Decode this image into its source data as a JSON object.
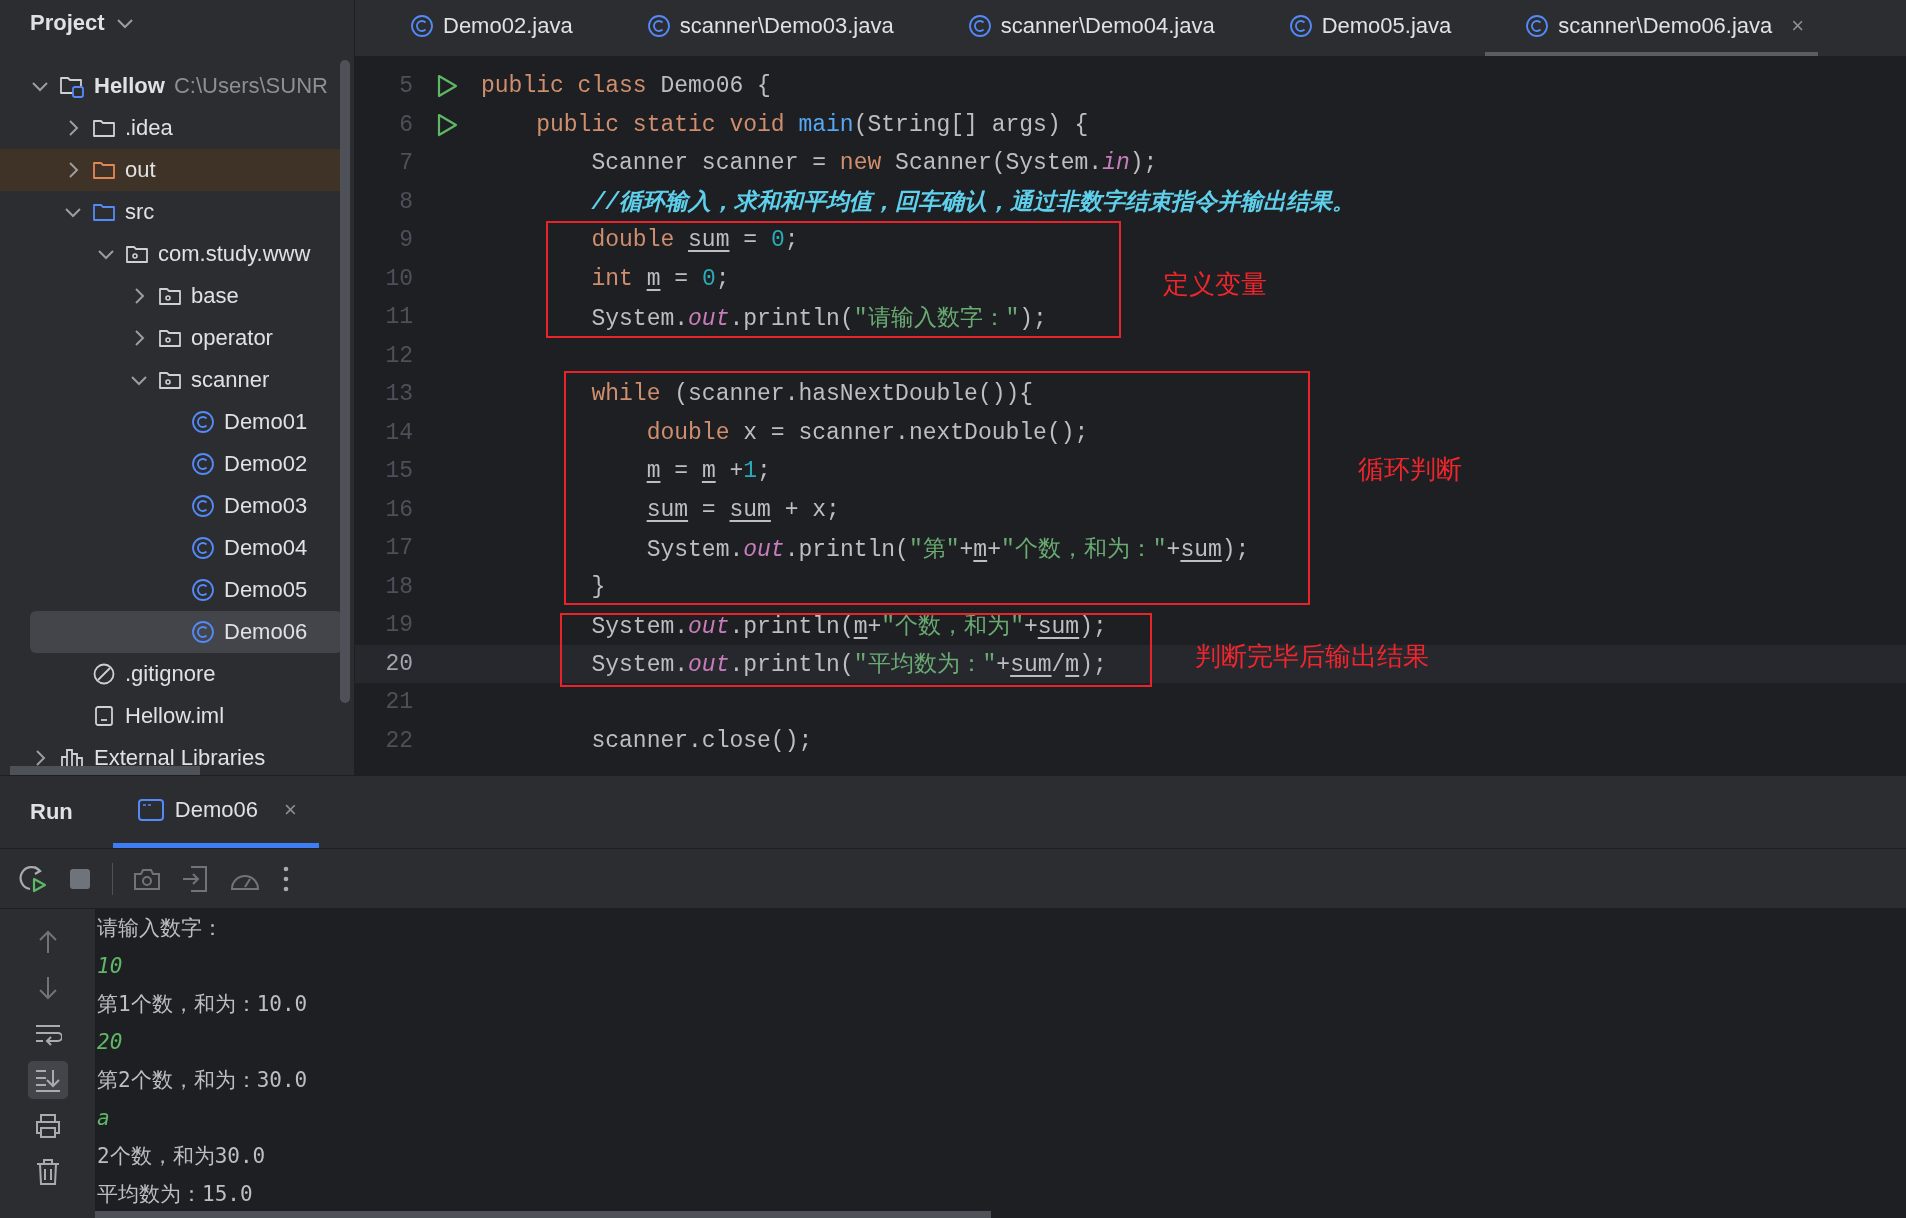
{
  "project_panel": {
    "title": "Project",
    "tree": [
      {
        "kind": "module",
        "label": "Hellow",
        "detail": "C:\\Users\\SUNR",
        "expanded": true,
        "selected": false,
        "children": [
          {
            "kind": "folder",
            "label": ".idea",
            "expanded": false,
            "selected": false
          },
          {
            "kind": "excluded-folder",
            "label": "out",
            "expanded": false,
            "selected": false
          },
          {
            "kind": "source-folder",
            "label": "src",
            "expanded": true,
            "selected": false,
            "children": [
              {
                "kind": "package",
                "label": "com.study.www",
                "expanded": true,
                "selected": false,
                "children": [
                  {
                    "kind": "package",
                    "label": "base",
                    "expanded": false,
                    "selected": false
                  },
                  {
                    "kind": "package",
                    "label": "operator",
                    "expanded": false,
                    "selected": false
                  },
                  {
                    "kind": "package",
                    "label": "scanner",
                    "expanded": true,
                    "selected": false,
                    "children": [
                      {
                        "kind": "class",
                        "label": "Demo01",
                        "selected": false
                      },
                      {
                        "kind": "class",
                        "label": "Demo02",
                        "selected": false
                      },
                      {
                        "kind": "class",
                        "label": "Demo03",
                        "selected": false
                      },
                      {
                        "kind": "class",
                        "label": "Demo04",
                        "selected": false
                      },
                      {
                        "kind": "class",
                        "label": "Demo05",
                        "selected": false
                      },
                      {
                        "kind": "class",
                        "label": "Demo06",
                        "selected": true
                      }
                    ]
                  }
                ]
              }
            ]
          },
          {
            "kind": "ignore-file",
            "label": ".gitignore",
            "selected": false
          },
          {
            "kind": "iml-file",
            "label": "Hellow.iml",
            "selected": false
          }
        ]
      },
      {
        "kind": "libraries",
        "label": "External Libraries",
        "expanded": false,
        "selected": false
      }
    ]
  },
  "editor_tabs": [
    {
      "label": "Demo02.java",
      "selected": false
    },
    {
      "label": "scanner\\Demo03.java",
      "selected": false
    },
    {
      "label": "scanner\\Demo04.java",
      "selected": false
    },
    {
      "label": "Demo05.java",
      "selected": false
    },
    {
      "label": "scanner\\Demo06.java",
      "selected": true,
      "close": "×"
    }
  ],
  "code": [
    {
      "number": "5",
      "runnable": true,
      "current": false,
      "tokens": [
        {
          "kind": "keyword",
          "text": "public class "
        },
        {
          "kind": "plain",
          "text": "Demo06 {"
        }
      ]
    },
    {
      "number": "6",
      "runnable": true,
      "current": false,
      "tokens": [
        {
          "kind": "keyword",
          "text": "    public static void "
        },
        {
          "kind": "method",
          "text": "main"
        },
        {
          "kind": "plain",
          "text": "(String[] args) {"
        }
      ]
    },
    {
      "number": "7",
      "runnable": false,
      "current": false,
      "tokens": [
        {
          "kind": "plain",
          "text": "        Scanner scanner = "
        },
        {
          "kind": "keyword",
          "text": "new"
        },
        {
          "kind": "plain",
          "text": " Scanner(System."
        },
        {
          "kind": "field",
          "text": "in"
        },
        {
          "kind": "plain",
          "text": ");"
        }
      ]
    },
    {
      "number": "8",
      "runnable": false,
      "current": false,
      "tokens": [
        {
          "kind": "comment",
          "text": "        //循环输入，求和和平均值，回车确认，通过非数字结束指令并输出结果。"
        }
      ]
    },
    {
      "number": "9",
      "runnable": false,
      "current": false,
      "tokens": [
        {
          "kind": "keyword",
          "text": "        double "
        },
        {
          "kind": "var",
          "text": "sum"
        },
        {
          "kind": "plain",
          "text": " = "
        },
        {
          "kind": "number",
          "text": "0"
        },
        {
          "kind": "plain",
          "text": ";"
        }
      ]
    },
    {
      "number": "10",
      "runnable": false,
      "current": false,
      "tokens": [
        {
          "kind": "keyword",
          "text": "        int "
        },
        {
          "kind": "var",
          "text": "m"
        },
        {
          "kind": "plain",
          "text": " = "
        },
        {
          "kind": "number",
          "text": "0"
        },
        {
          "kind": "plain",
          "text": ";"
        }
      ]
    },
    {
      "number": "11",
      "runnable": false,
      "current": false,
      "tokens": [
        {
          "kind": "plain",
          "text": "        System."
        },
        {
          "kind": "field",
          "text": "out"
        },
        {
          "kind": "plain",
          "text": ".println("
        },
        {
          "kind": "string",
          "text": "\"请输入数字：\""
        },
        {
          "kind": "plain",
          "text": ");"
        }
      ]
    },
    {
      "number": "12",
      "runnable": false,
      "current": false
    },
    {
      "number": "13",
      "runnable": false,
      "current": false,
      "tokens": [
        {
          "kind": "keyword",
          "text": "        while"
        },
        {
          "kind": "plain",
          "text": " (scanner.hasNextDouble()){"
        }
      ]
    },
    {
      "number": "14",
      "runnable": false,
      "current": false,
      "tokens": [
        {
          "kind": "keyword",
          "text": "            double"
        },
        {
          "kind": "plain",
          "text": " x = scanner.nextDouble();"
        }
      ]
    },
    {
      "number": "15",
      "runnable": false,
      "current": false,
      "tokens": [
        {
          "kind": "var",
          "text": "            m"
        },
        {
          "kind": "plain",
          "text": " = "
        },
        {
          "kind": "var",
          "text": "m"
        },
        {
          "kind": "plain",
          "text": " +"
        },
        {
          "kind": "number",
          "text": "1"
        },
        {
          "kind": "plain",
          "text": ";"
        }
      ]
    },
    {
      "number": "16",
      "runnable": false,
      "current": false,
      "tokens": [
        {
          "kind": "var",
          "text": "            sum"
        },
        {
          "kind": "plain",
          "text": " = "
        },
        {
          "kind": "var",
          "text": "sum"
        },
        {
          "kind": "plain",
          "text": " + x;"
        }
      ]
    },
    {
      "number": "17",
      "runnable": false,
      "current": false,
      "tokens": [
        {
          "kind": "plain",
          "text": "            System."
        },
        {
          "kind": "field",
          "text": "out"
        },
        {
          "kind": "plain",
          "text": ".println("
        },
        {
          "kind": "string",
          "text": "\"第\""
        },
        {
          "kind": "plain",
          "text": "+"
        },
        {
          "kind": "var",
          "text": "m"
        },
        {
          "kind": "plain",
          "text": "+"
        },
        {
          "kind": "string",
          "text": "\"个数，和为：\""
        },
        {
          "kind": "plain",
          "text": "+"
        },
        {
          "kind": "var",
          "text": "sum"
        },
        {
          "kind": "plain",
          "text": ");"
        }
      ]
    },
    {
      "number": "18",
      "runnable": false,
      "current": false,
      "tokens": [
        {
          "kind": "plain",
          "text": "        }"
        }
      ]
    },
    {
      "number": "19",
      "runnable": false,
      "current": false,
      "tokens": [
        {
          "kind": "plain",
          "text": "        System."
        },
        {
          "kind": "field",
          "text": "out"
        },
        {
          "kind": "plain",
          "text": ".println("
        },
        {
          "kind": "var",
          "text": "m"
        },
        {
          "kind": "plain",
          "text": "+"
        },
        {
          "kind": "string",
          "text": "\"个数，和为\""
        },
        {
          "kind": "plain",
          "text": "+"
        },
        {
          "kind": "var",
          "text": "sum"
        },
        {
          "kind": "plain",
          "text": ");"
        }
      ]
    },
    {
      "number": "20",
      "runnable": false,
      "current": true,
      "tokens": [
        {
          "kind": "plain",
          "text": "        System."
        },
        {
          "kind": "field",
          "text": "out"
        },
        {
          "kind": "plain",
          "text": ".println("
        },
        {
          "kind": "string",
          "text": "\"平均数为：\""
        },
        {
          "kind": "plain",
          "text": "+"
        },
        {
          "kind": "var",
          "text": "sum"
        },
        {
          "kind": "plain",
          "text": "/"
        },
        {
          "kind": "var",
          "text": "m"
        },
        {
          "kind": "plain",
          "text": ");"
        }
      ]
    },
    {
      "number": "21",
      "runnable": false,
      "current": false
    },
    {
      "number": "22",
      "runnable": false,
      "current": false,
      "tokens": [
        {
          "kind": "plain",
          "text": "        scanner.close();"
        }
      ]
    }
  ],
  "annotations": [
    {
      "label": "定义变量"
    },
    {
      "label": "循环判断"
    },
    {
      "label": "判断完毕后输出结果"
    }
  ],
  "run_panel": {
    "title": "Run",
    "tabs": [
      {
        "label": "Demo06",
        "selected": true,
        "close": "×"
      }
    ],
    "side_tools": [
      {
        "kind": "up",
        "selected": false
      },
      {
        "kind": "down",
        "selected": false
      },
      {
        "kind": "wrap",
        "selected": false
      },
      {
        "kind": "scroll-end",
        "selected": true
      },
      {
        "kind": "print",
        "selected": false
      },
      {
        "kind": "clear",
        "selected": false
      }
    ],
    "console": [
      {
        "kind": "output",
        "text": "请输入数字："
      },
      {
        "kind": "input",
        "text": "10"
      },
      {
        "kind": "output",
        "text": "第1个数，和为：10.0"
      },
      {
        "kind": "input",
        "text": "20"
      },
      {
        "kind": "output",
        "text": "第2个数，和为：30.0"
      },
      {
        "kind": "input",
        "text": "a"
      },
      {
        "kind": "output",
        "text": "2个数，和为30.0"
      },
      {
        "kind": "output",
        "text": "平均数为：15.0"
      }
    ]
  }
}
